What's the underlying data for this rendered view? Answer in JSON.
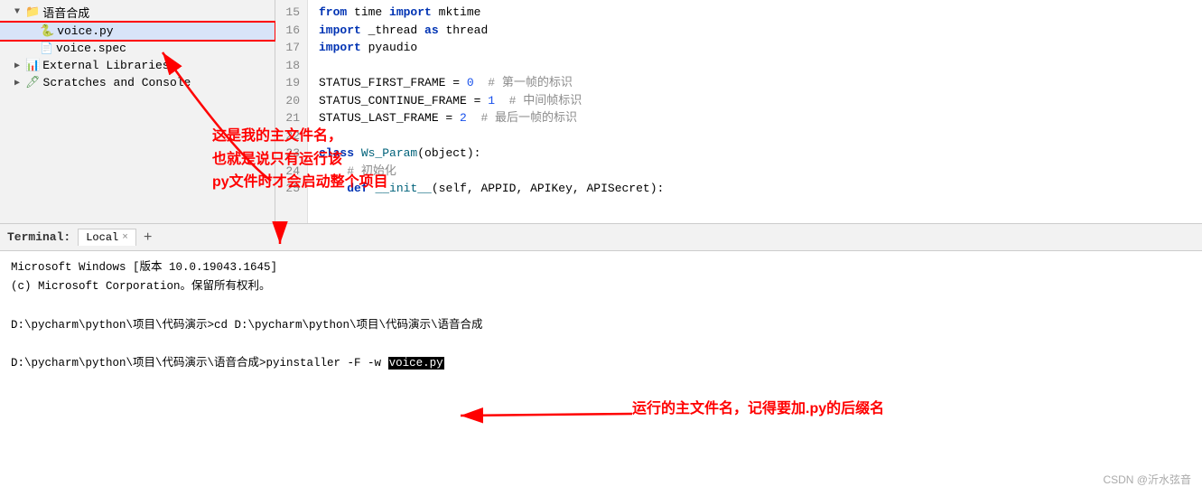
{
  "sidebar": {
    "items": [
      {
        "id": "yuyin",
        "label": "语音合成",
        "type": "folder",
        "level": 1,
        "expanded": true,
        "arrow": "▼"
      },
      {
        "id": "voicepy",
        "label": "voice.py",
        "type": "file",
        "level": 2,
        "selected": true
      },
      {
        "id": "voicespec",
        "label": "voice.spec",
        "type": "file",
        "level": 2
      },
      {
        "id": "external",
        "label": "External Libraries",
        "type": "folder",
        "level": 1,
        "expanded": false,
        "arrow": "▶"
      },
      {
        "id": "scratches",
        "label": "Scratches and Console",
        "type": "folder",
        "level": 1,
        "expanded": false,
        "arrow": "▶"
      }
    ]
  },
  "editor": {
    "lines": [
      {
        "num": 15,
        "code": "from time import mktime"
      },
      {
        "num": 16,
        "code": "import _thread as thread"
      },
      {
        "num": 17,
        "code": "import pyaudio"
      },
      {
        "num": 18,
        "code": ""
      },
      {
        "num": 19,
        "code": "STATUS_FIRST_FRAME = 0  # 第一帧的标识"
      },
      {
        "num": 20,
        "code": "STATUS_CONTINUE_FRAME = 1  # 中间帧标识"
      },
      {
        "num": 21,
        "code": "STATUS_LAST_FRAME = 2  # 最后一帧的标识"
      },
      {
        "num": 22,
        "code": ""
      },
      {
        "num": 23,
        "code": "class Ws_Param(object):"
      },
      {
        "num": 24,
        "code": "    # 初始化"
      },
      {
        "num": 25,
        "code": "    def __init__(self, APPID, APIKey, APISecret):"
      }
    ]
  },
  "terminal": {
    "label": "Terminal:",
    "tab_label": "Local",
    "add_btn": "+",
    "lines": [
      "Microsoft Windows [版本 10.0.19043.1645]",
      "(c) Microsoft Corporation。保留所有权利。",
      "",
      "D:\\pycharm\\python\\项目\\代码演示>cd D:\\pycharm\\python\\项目\\代码演示\\语音合成",
      "",
      "D:\\pycharm\\python\\项目\\代码演示\\语音合成>pyinstaller -F -w voice.py"
    ]
  },
  "annotations": {
    "left": "这是我的主文件名，\n也就是说只有运行该\npy文件时才会启动整个项目",
    "right": "运行的主文件名，记得要加.py的后缀名"
  },
  "watermark": "CSDN @沂水弦音"
}
